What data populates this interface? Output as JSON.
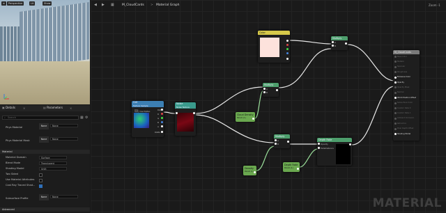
{
  "viewport": {
    "mode_button": "Perspective",
    "lit_button": "Lit",
    "show_button": "Show"
  },
  "details": {
    "tabs": [
      {
        "label": "Details"
      },
      {
        "label": "Parameters"
      }
    ],
    "search_placeholder": "Search",
    "phys_material": {
      "label": "Phys Material",
      "swatch": "None",
      "value": "None"
    },
    "phys_material_mask": {
      "label": "Phys Material Mask",
      "swatch": "None",
      "value": "None"
    },
    "section_material": "Material",
    "material_domain": {
      "label": "Material Domain",
      "value": "Surface"
    },
    "blend_mode": {
      "label": "Blend Mode",
      "value": "Translucent"
    },
    "shading_model": {
      "label": "Shading Model",
      "value": "Unlit"
    },
    "two_sided": {
      "label": "Two Sided"
    },
    "use_material_attributes": {
      "label": "Use Material Attributes"
    },
    "cast_ray_traced_shadows": {
      "label": "Cast Ray Traced Shad..."
    },
    "subsurface_profile": {
      "label": "Subsurface Profile",
      "swatch": "None",
      "value": "None"
    },
    "section_advanced": "Advanced"
  },
  "graph": {
    "breadcrumb_asset": "M_CloudCards",
    "breadcrumb_sep": ">",
    "breadcrumb_graph": "Material Graph",
    "zoom": "Zoom -1",
    "watermark": "MATERIAL"
  },
  "nodes": {
    "texture": {
      "title": "Cell",
      "subtitle": "Texture Sample",
      "pins": [
        "UVs",
        "Apply View MipBias",
        "RGB",
        "R",
        "G",
        "B",
        "A",
        "RGBA"
      ]
    },
    "noise": {
      "title": "Noise",
      "subtitle": "Noise Texture"
    },
    "color": {
      "title": "Color",
      "pins": [
        "R",
        "G",
        "B",
        "A"
      ]
    },
    "multiply_top": {
      "title": "Multiply",
      "pins": [
        "A",
        "B"
      ]
    },
    "multiply_mid": {
      "title": "Multiply",
      "pins": [
        "A",
        "B"
      ]
    },
    "cloud_density": {
      "title": "Cloud Density",
      "subtitle": "Param (1)"
    },
    "multiply_low": {
      "title": "Multiply",
      "pins": [
        "A",
        "B"
      ]
    },
    "depth_fade": {
      "title": "Depth Fade",
      "pins": [
        "Opacity",
        "FadeDistance"
      ]
    },
    "density": {
      "title": "Density",
      "subtitle": "Param (1)"
    },
    "fade_dist": {
      "title": "Depth Fade",
      "subtitle": "Param (1)"
    },
    "result": {
      "title": "M_CloudCards",
      "pins": [
        "Base Color",
        "Metallic",
        "Specular",
        "Roughness",
        "Emissive Color",
        "Opacity",
        "Opacity Mask",
        "Normal",
        "World Position Offset",
        "Subsurface Color",
        "Custom Data 0",
        "Custom Data 1",
        "Ambient Occlusion",
        "Refraction",
        "Pixel Depth Offset",
        "Shading Model"
      ]
    }
  }
}
